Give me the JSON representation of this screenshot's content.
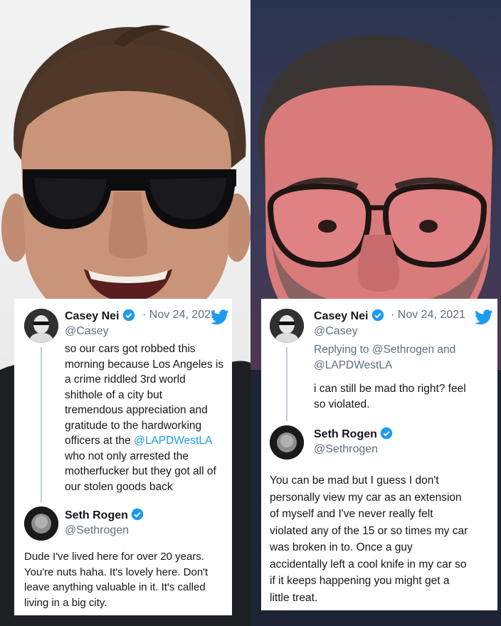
{
  "left_tweet": {
    "author": {
      "name": "Casey Nei",
      "date": "· Nov 24, 2021",
      "handle": "@Casey"
    },
    "body_lines": [
      "so our cars got robbed this",
      "morning because Los Angeles is",
      "a crime riddled 3rd world",
      "shithole of a city but",
      "tremendous appreciation and",
      "gratitude to the hardworking",
      "officers at the ",
      "who not only arrested the",
      "motherfucker but they got all of",
      "our stolen goods back"
    ],
    "mention": "@LAPDWestLA",
    "reply": {
      "name": "Seth Rogen",
      "handle": "@Sethrogen",
      "body_lines": [
        "Dude I've lived here for over 20 years.",
        "You're nuts haha. It's lovely here. Don't",
        "leave anything valuable in it. It's called",
        "living in a big city."
      ]
    }
  },
  "right_tweet": {
    "author": {
      "name": "Casey Nei",
      "date": "· Nov 24, 2021",
      "handle": "@Casey"
    },
    "replying_line1": "Replying to @Sethrogen and",
    "replying_line2": "@LAPDWestLA",
    "body_lines": [
      "i can still be mad tho right?  feel",
      "so violated."
    ],
    "reply": {
      "name": "Seth Rogen",
      "handle": "@Sethrogen",
      "body_lines": [
        "You can be mad but I guess I don't",
        "personally view my car as an extension",
        "of myself and I've never really felt",
        "violated any of the 15 or so times my car",
        "was broken in to. Once a guy",
        "accidentally left a cool knife in my car so",
        "if it keeps happening you might get a",
        "little treat."
      ]
    }
  },
  "colors": {
    "link": "#1d9bf0",
    "verified": "#1d9bf0",
    "muted": "#5b7083"
  },
  "icons": [
    "twitter-bird-icon",
    "verified-badge-icon"
  ]
}
